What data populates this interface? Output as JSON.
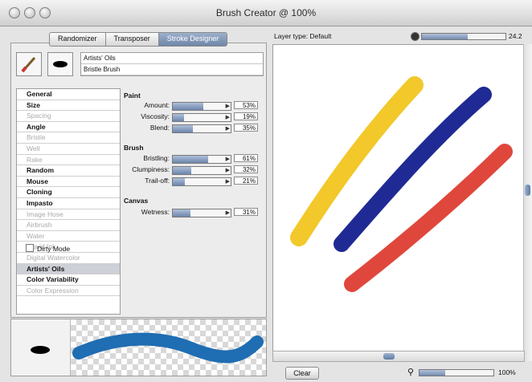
{
  "window": {
    "title": "Brush Creator @ 100%"
  },
  "tabs": [
    {
      "label": "Randomizer"
    },
    {
      "label": "Transposer"
    },
    {
      "label": "Stroke Designer",
      "active": true
    }
  ],
  "brush": {
    "category": "Artists' Oils",
    "variant": "Bristle Brush"
  },
  "categories": [
    {
      "label": "General",
      "enabled": true
    },
    {
      "label": "Size",
      "enabled": true
    },
    {
      "label": "Spacing",
      "enabled": false
    },
    {
      "label": "Angle",
      "enabled": true
    },
    {
      "label": "Bristle",
      "enabled": false
    },
    {
      "label": "Well",
      "enabled": false
    },
    {
      "label": "Rake",
      "enabled": false
    },
    {
      "label": "Random",
      "enabled": true
    },
    {
      "label": "Mouse",
      "enabled": true
    },
    {
      "label": "Cloning",
      "enabled": true
    },
    {
      "label": "Impasto",
      "enabled": true
    },
    {
      "label": "Image Hose",
      "enabled": false
    },
    {
      "label": "Airbrush",
      "enabled": false
    },
    {
      "label": "Water",
      "enabled": false
    },
    {
      "label": "Liquid Ink",
      "enabled": false
    },
    {
      "label": "Digital Watercolor",
      "enabled": false
    },
    {
      "label": "Artists' Oils",
      "enabled": true,
      "selected": true
    },
    {
      "label": "Color Variability",
      "enabled": true
    },
    {
      "label": "Color Expression",
      "enabled": false
    }
  ],
  "groups": {
    "paint": "Paint",
    "brush": "Brush",
    "canvas": "Canvas"
  },
  "params": {
    "amount": {
      "label": "Amount:",
      "value": "53%",
      "level": 0.53
    },
    "viscosity": {
      "label": "Viscosity:",
      "value": "19%",
      "level": 0.19
    },
    "blend": {
      "label": "Blend:",
      "value": "35%",
      "level": 0.35
    },
    "bristling": {
      "label": "Bristling:",
      "value": "61%",
      "level": 0.61
    },
    "clumpiness": {
      "label": "Clumpiness:",
      "value": "32%",
      "level": 0.32
    },
    "trailoff": {
      "label": "Trail-off:",
      "value": "21%",
      "level": 0.21
    },
    "wetness": {
      "label": "Wetness:",
      "value": "31%",
      "level": 0.31
    }
  },
  "dirty_mode": {
    "label": "Dirty Mode",
    "checked": false
  },
  "canvas": {
    "layer_type": "Layer type: Default",
    "brush_size": "24.2",
    "brush_size_level": 0.55
  },
  "bottom": {
    "clear_label": "Clear",
    "zoom": "100%",
    "zoom_level": 0.35
  },
  "strokes": [
    {
      "color": "#f2c82a"
    },
    {
      "color": "#1f2a94"
    },
    {
      "color": "#e0473c"
    }
  ],
  "preview_stroke_color": "#1f6db3"
}
